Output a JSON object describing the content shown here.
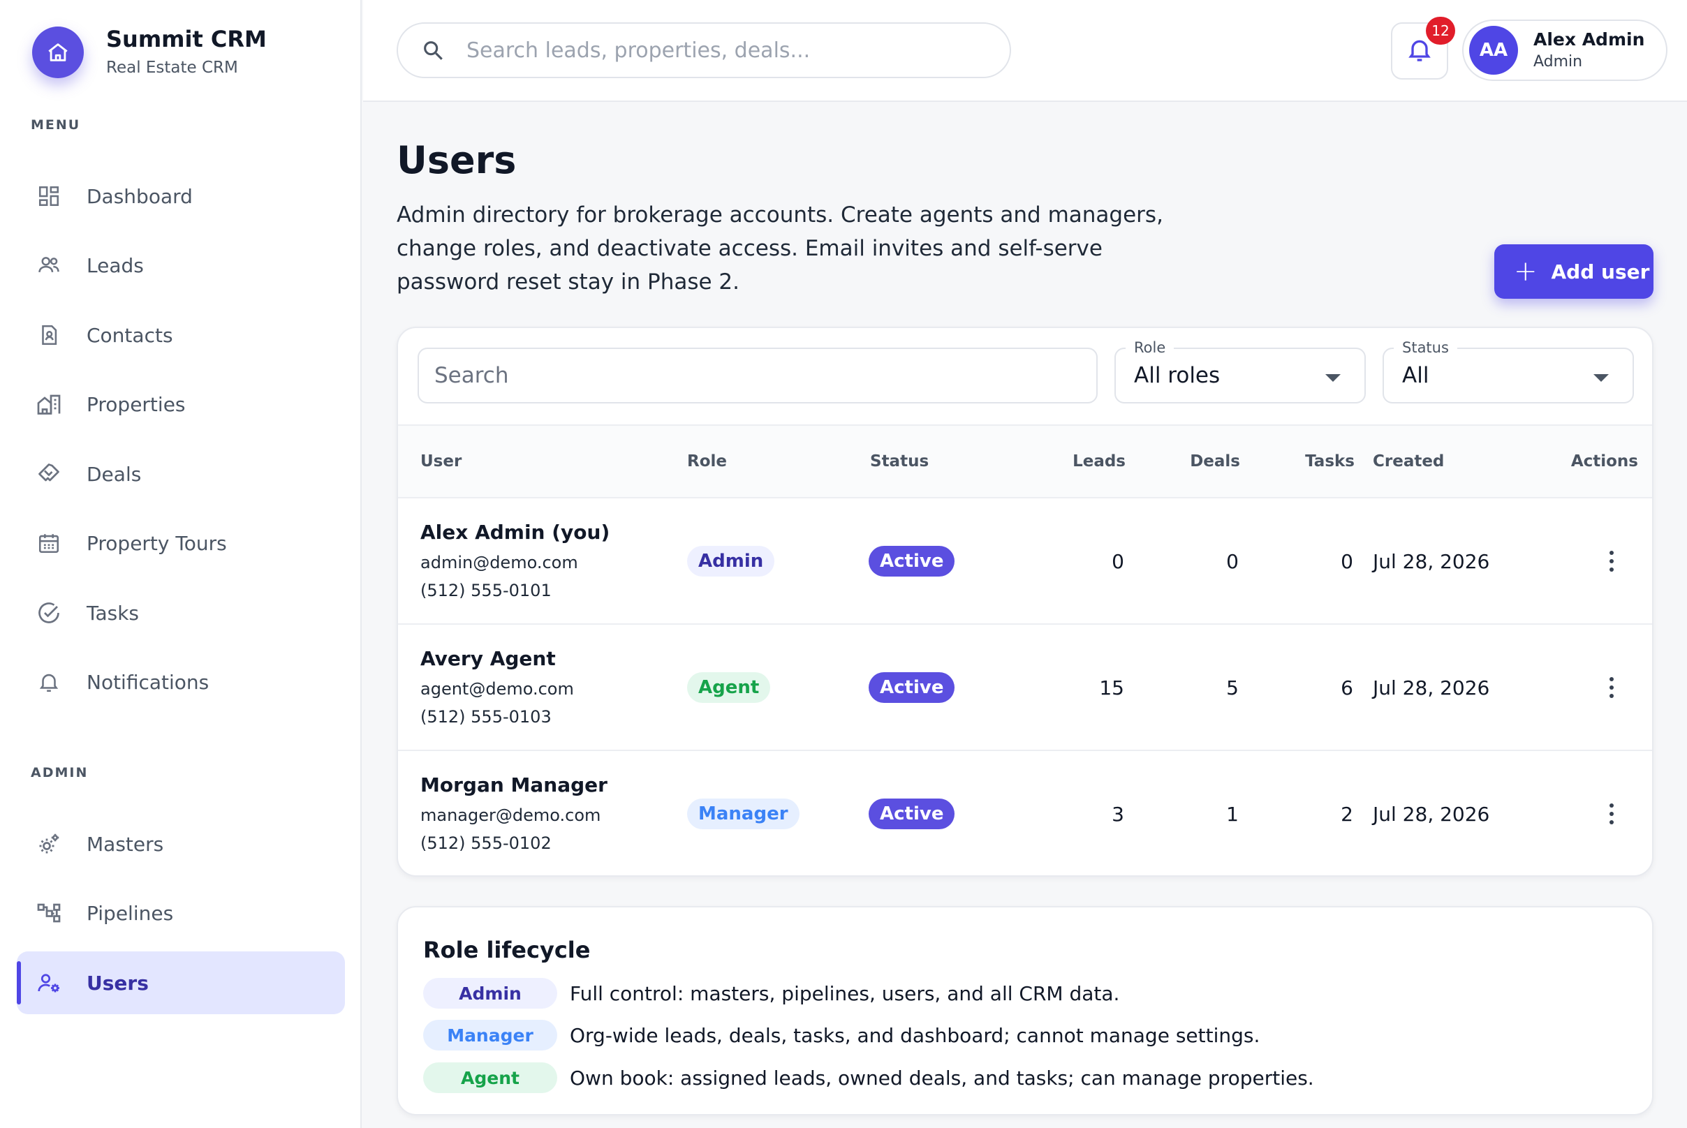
{
  "brand": {
    "name": "Summit CRM",
    "subtitle": "Real Estate CRM"
  },
  "sidebar": {
    "menu_label": "MENU",
    "admin_label": "ADMIN",
    "items": [
      {
        "label": "Dashboard",
        "icon": "dashboard-icon"
      },
      {
        "label": "Leads",
        "icon": "people-icon"
      },
      {
        "label": "Contacts",
        "icon": "contact-card-icon"
      },
      {
        "label": "Properties",
        "icon": "buildings-icon"
      },
      {
        "label": "Deals",
        "icon": "handshake-icon"
      },
      {
        "label": "Property Tours",
        "icon": "calendar-icon"
      },
      {
        "label": "Tasks",
        "icon": "check-circle-icon"
      },
      {
        "label": "Notifications",
        "icon": "bell-icon"
      }
    ],
    "admin_items": [
      {
        "label": "Masters",
        "icon": "gears-icon"
      },
      {
        "label": "Pipelines",
        "icon": "pipeline-icon"
      },
      {
        "label": "Users",
        "icon": "user-settings-icon",
        "active": true
      }
    ]
  },
  "header": {
    "search_placeholder": "Search leads, properties, deals...",
    "notification_count": "12",
    "user_initials": "AA",
    "user_name": "Alex Admin",
    "user_role": "Admin"
  },
  "page": {
    "title": "Users",
    "description": "Admin directory for brokerage accounts. Create agents and managers, change roles, and deactivate access. Email invites and self-serve password reset stay in Phase 2.",
    "add_button": "Add user"
  },
  "filters": {
    "search_placeholder": "Search",
    "role_label": "Role",
    "role_value": "All roles",
    "status_label": "Status",
    "status_value": "All"
  },
  "table": {
    "columns": [
      "User",
      "Role",
      "Status",
      "Leads",
      "Deals",
      "Tasks",
      "Created",
      "Actions"
    ],
    "rows": [
      {
        "name": "Alex Admin (you)",
        "email": "admin@demo.com",
        "phone": "(512) 555-0101",
        "role": "Admin",
        "status": "Active",
        "leads": "0",
        "deals": "0",
        "tasks": "0",
        "created": "Jul 28, 2026"
      },
      {
        "name": "Avery Agent",
        "email": "agent@demo.com",
        "phone": "(512) 555-0103",
        "role": "Agent",
        "status": "Active",
        "leads": "15",
        "deals": "5",
        "tasks": "6",
        "created": "Jul 28, 2026"
      },
      {
        "name": "Morgan Manager",
        "email": "manager@demo.com",
        "phone": "(512) 555-0102",
        "role": "Manager",
        "status": "Active",
        "leads": "3",
        "deals": "1",
        "tasks": "2",
        "created": "Jul 28, 2026"
      }
    ]
  },
  "lifecycle": {
    "title": "Role lifecycle",
    "items": [
      {
        "role": "Admin",
        "text": "Full control: masters, pipelines, users, and all CRM data."
      },
      {
        "role": "Manager",
        "text": "Org-wide leads, deals, tasks, and dashboard; cannot manage settings."
      },
      {
        "role": "Agent",
        "text": "Own book: assigned leads, owned deals, and tasks; can manage properties."
      }
    ]
  },
  "colors": {
    "accent": "#4f46e5",
    "active_nav_bg": "#e3e6ff",
    "badge_red": "#e11d2a",
    "agent_green": "#16a34a",
    "manager_blue": "#3b82f6"
  }
}
